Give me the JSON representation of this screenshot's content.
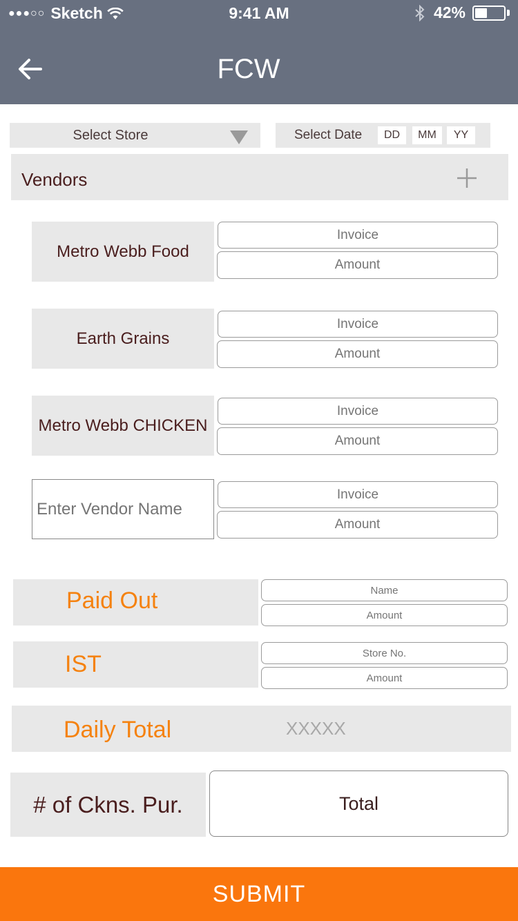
{
  "status_bar": {
    "carrier": "Sketch",
    "signal_dots": "●●●○○",
    "time": "9:41 AM",
    "battery_percent": "42%",
    "battery_level": 0.42
  },
  "nav": {
    "title": "FCW",
    "back_icon": "arrow-left-icon"
  },
  "filters": {
    "store_label": "Select Store",
    "date_label": "Select Date",
    "dd": "DD",
    "mm": "MM",
    "yy": "YY"
  },
  "vendors": {
    "label": "Vendors",
    "add_icon": "plus-icon",
    "items": [
      {
        "name": "Metro Webb Food",
        "invoice_placeholder": "Invoice",
        "amount_placeholder": "Amount"
      },
      {
        "name": "Earth Grains",
        "invoice_placeholder": "Invoice",
        "amount_placeholder": "Amount"
      },
      {
        "name": "Metro Webb CHICKEN",
        "invoice_placeholder": "Invoice",
        "amount_placeholder": "Amount"
      }
    ],
    "new_vendor": {
      "placeholder": "Enter Vendor Name",
      "invoice_placeholder": "Invoice",
      "amount_placeholder": "Amount"
    }
  },
  "paid_out": {
    "label": "Paid Out",
    "name_placeholder": "Name",
    "amount_placeholder": "Amount"
  },
  "ist": {
    "label": "IST",
    "store_placeholder": "Store No.",
    "amount_placeholder": "Amount"
  },
  "daily_total": {
    "label": "Daily Total",
    "value": "XXXXX"
  },
  "chickens": {
    "label": "# of Ckns. Pur.",
    "total_placeholder": "Total"
  },
  "submit_label": "SUBMIT",
  "colors": {
    "header": "#687080",
    "accent": "#fa760d",
    "label_orange": "#f5820f",
    "panel": "#e8e8e8"
  }
}
